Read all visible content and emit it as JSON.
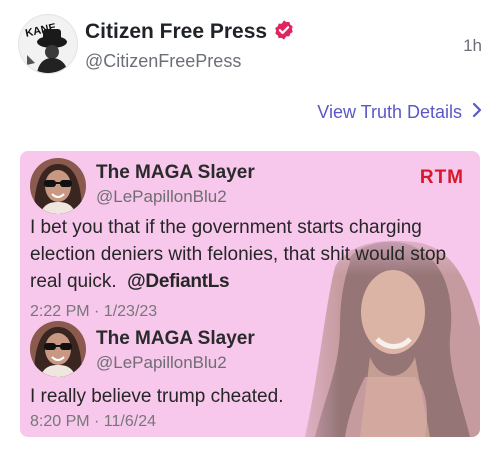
{
  "post": {
    "author_name": "Citizen Free Press",
    "handle": "@CitizenFreePress",
    "time": "1h",
    "avatar_text": "KANE",
    "verified_icon": "verified-badge-icon",
    "accent_color": "#e0245e"
  },
  "view_details": {
    "label": "View Truth Details",
    "icon": "chevron-right-icon",
    "color": "#5b57c9"
  },
  "quote": {
    "background": "#f7c7ec",
    "watermark": "RTM",
    "tweets": [
      {
        "name": "The MAGA Slayer",
        "handle": "@LePapillonBlu2",
        "text": "I bet you that if the government starts charging election deniers with felonies, that shit would stop real quick.",
        "mention": "@DefiantLs",
        "date": "2:22 PM · 1/23/23"
      },
      {
        "name": "The MAGA Slayer",
        "handle": "@LePapillonBlu2",
        "text": "I really believe trump cheated.",
        "date": "8:20 PM · 11/6/24"
      }
    ]
  }
}
